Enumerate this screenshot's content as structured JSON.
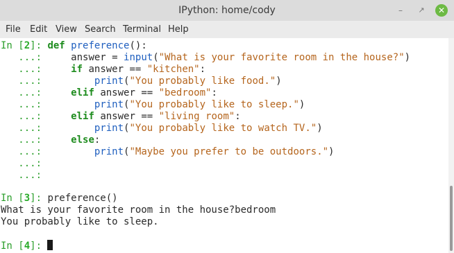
{
  "window": {
    "title": "IPython: home/cody",
    "minimize_glyph": "–",
    "maximize_glyph": "↗",
    "close_glyph": "✕"
  },
  "menu": [
    "File",
    "Edit",
    "View",
    "Search",
    "Terminal",
    "Help"
  ],
  "terminal": {
    "in2_label": "In [",
    "in2_num": "2",
    "in2_close": "]: ",
    "def_kw": "def ",
    "func_name": "preference",
    "def_tail": "():",
    "cont": "   ...:",
    "l1_a": "     answer = ",
    "l1_fn": "input",
    "l1_b": "(",
    "l1_str": "\"What is your favorite room in the house?\"",
    "l1_c": ")",
    "l2_ind": "     ",
    "l2_kw": "if",
    "l2_a": " answer == ",
    "l2_str": "\"kitchen\"",
    "l2_b": ":",
    "l3_ind": "         ",
    "l3_fn": "print",
    "l3_a": "(",
    "l3_str": "\"You probably like food.\"",
    "l3_b": ")",
    "l4_ind": "     ",
    "l4_kw": "elif",
    "l4_a": " answer == ",
    "l4_str": "\"bedroom\"",
    "l4_b": ":",
    "l5_ind": "         ",
    "l5_fn": "print",
    "l5_a": "(",
    "l5_str": "\"You probably like to sleep.\"",
    "l5_b": ")",
    "l6_ind": "     ",
    "l6_kw": "elif",
    "l6_a": " answer == ",
    "l6_str": "\"living room\"",
    "l6_b": ":",
    "l7_ind": "         ",
    "l7_fn": "print",
    "l7_a": "(",
    "l7_str": "\"You probably like to watch TV.\"",
    "l7_b": ")",
    "l8_ind": "     ",
    "l8_kw": "else",
    "l8_a": ":",
    "l9_ind": "         ",
    "l9_fn": "print",
    "l9_a": "(",
    "l9_str": "\"Maybe you prefer to be outdoors.\"",
    "l9_b": ")",
    "in3_label": "In [",
    "in3_num": "3",
    "in3_close": "]: ",
    "in3_cmd": "preference()",
    "out1": "What is your favorite room in the house?bedroom",
    "out2": "You probably like to sleep.",
    "in4_label": "In [",
    "in4_num": "4",
    "in4_close": "]: "
  }
}
